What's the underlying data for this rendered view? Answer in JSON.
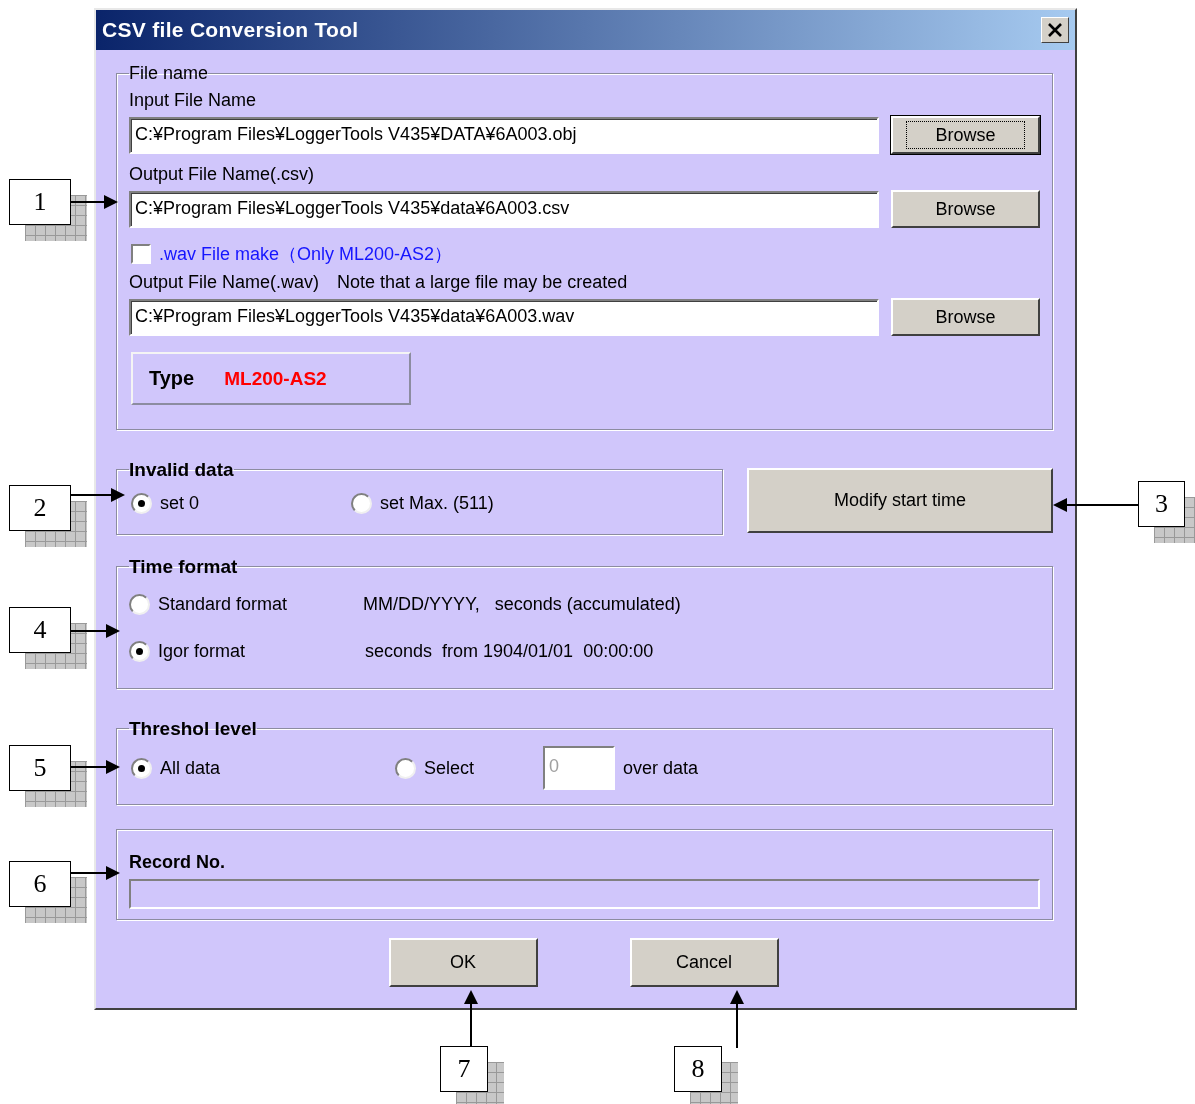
{
  "window": {
    "title": "CSV file Conversion Tool"
  },
  "file_name": {
    "legend": "File name",
    "input_label": "Input File Name",
    "input_value": "C:¥Program Files¥LoggerTools V435¥DATA¥6A003.obj",
    "output_csv_label": "Output File Name(.csv)",
    "output_csv_value": "C:¥Program Files¥LoggerTools V435¥data¥6A003.csv",
    "wav_checkbox": {
      "label": ".wav File make（Only ML200-AS2）",
      "checked": false
    },
    "output_wav_label": "Output File Name(.wav)",
    "output_wav_note": "Note that a large file may be created",
    "output_wav_value": "C:¥Program Files¥LoggerTools V435¥data¥6A003.wav",
    "type_label": "Type",
    "type_value": "ML200-AS2",
    "browse_buttons": [
      {
        "label": "Browse",
        "focused": true
      },
      {
        "label": "Browse",
        "focused": false
      },
      {
        "label": "Browse",
        "focused": false
      }
    ]
  },
  "invalid_data": {
    "legend": "Invalid data",
    "options": [
      {
        "label": "set 0",
        "selected": true
      },
      {
        "label": "set Max. (511)",
        "selected": false
      }
    ]
  },
  "modify_button": "Modify start time",
  "time_format": {
    "legend": "Time format",
    "options": [
      {
        "label": "Standard format",
        "detail": "MM/DD/YYYY,   seconds (accumulated)",
        "selected": false
      },
      {
        "label": "Igor format",
        "detail": "seconds  from 1904/01/01  00:00:00",
        "selected": true
      }
    ]
  },
  "threshold_level": {
    "legend": "Threshol level",
    "options": [
      {
        "label": "All data",
        "selected": true
      },
      {
        "label": "Select",
        "selected": false
      }
    ],
    "value": "0",
    "suffix": "over data"
  },
  "record": {
    "label": "Record No.",
    "level": 0
  },
  "buttons": [
    "OK",
    "Cancel"
  ],
  "callouts": [
    "1",
    "2",
    "3",
    "4",
    "5",
    "6",
    "7",
    "8"
  ]
}
